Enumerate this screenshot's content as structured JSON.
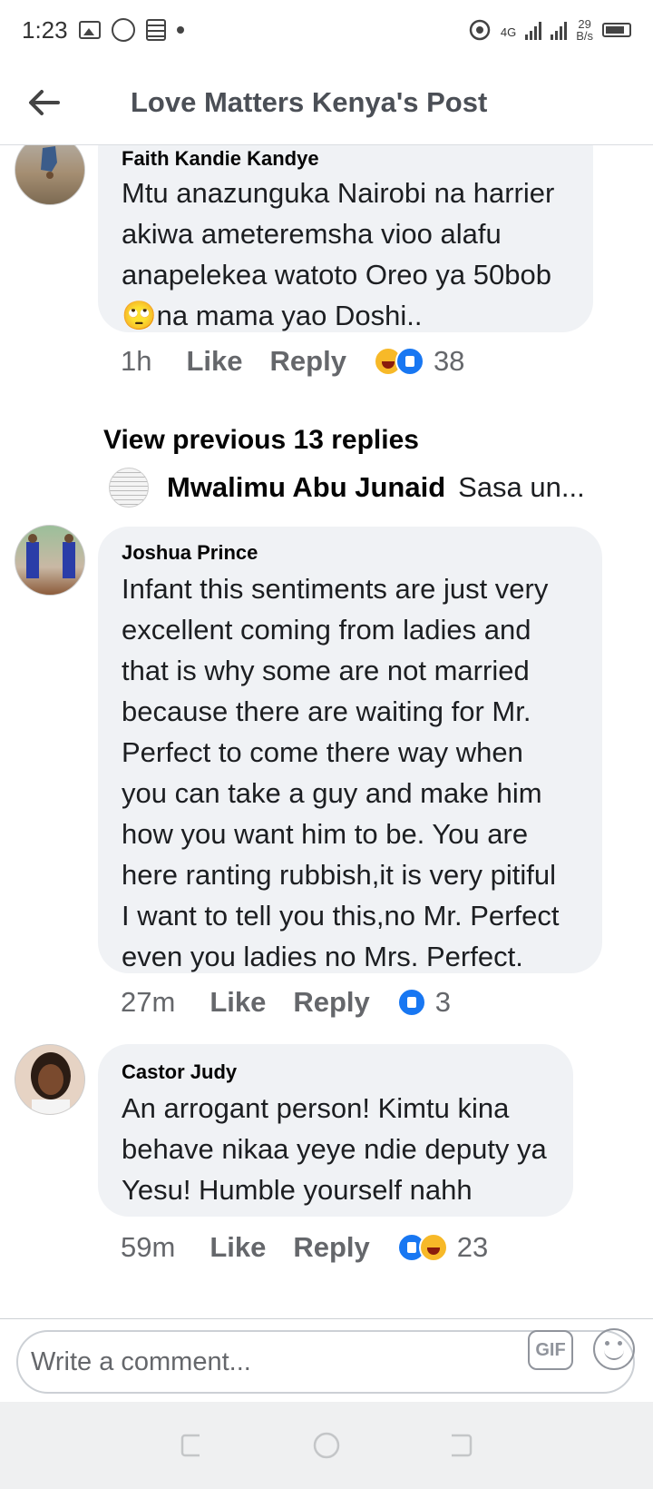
{
  "status_bar": {
    "time": "1:23",
    "network": "4G",
    "speed_value": "29",
    "speed_unit": "B/s"
  },
  "header": {
    "title": "Love Matters Kenya's Post"
  },
  "comments": [
    {
      "author": "Faith Kandie Kandye",
      "lines": [
        "Mtu anazunguka Nairobi na harrier",
        "akiwa ameteremsha vioo alafu",
        "anapelekea watoto Oreo ya 50bob",
        "🙄na mama yao Doshi.."
      ],
      "time": "1h",
      "like": "Like",
      "reply": "Reply",
      "reaction_count": "38",
      "reactions": [
        "haha",
        "like"
      ]
    },
    {
      "author": "Joshua Prince",
      "lines": [
        "Infant this sentiments are just very",
        "excellent coming from ladies and",
        "that is why some are not married",
        "because there are waiting for Mr.",
        "Perfect to come there way when",
        "you can take a guy and make him",
        "how you want him to be. You are",
        "here ranting rubbish,it is very pitiful",
        "I want to tell you this,no Mr. Perfect",
        "even you ladies no Mrs. Perfect."
      ],
      "time": "27m",
      "like": "Like",
      "reply": "Reply",
      "reaction_count": "3",
      "reactions": [
        "like"
      ]
    },
    {
      "author": "Castor Judy",
      "lines": [
        "An arrogant person! Kimtu kina",
        "behave nikaa yeye ndie deputy ya",
        "Yesu! Humble yourself nahh"
      ],
      "time": "59m",
      "like": "Like",
      "reply": "Reply",
      "reaction_count": "23",
      "reactions": [
        "like",
        "haha"
      ]
    }
  ],
  "view_previous": "View previous 13 replies",
  "reply_preview": {
    "author": "Mwalimu Abu Junaid",
    "snippet": "Sasa un..."
  },
  "composer": {
    "placeholder": "Write a comment...",
    "gif_label": "GIF"
  },
  "colors": {
    "bubble": "#f0f2f5",
    "like_blue": "#1877f2",
    "haha_yellow": "#f7b928",
    "meta_gray": "#65676b"
  }
}
